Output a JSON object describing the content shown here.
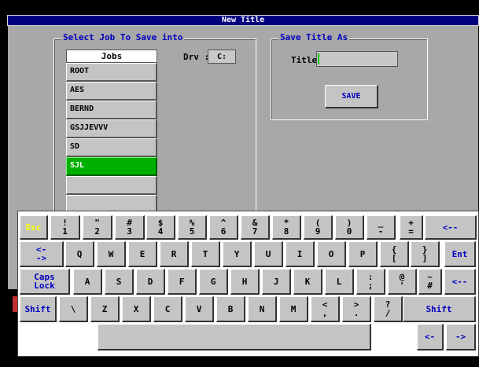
{
  "dialog": {
    "title": "New Title",
    "select_group_label": "Select Job To Save into",
    "save_group_label": "Save Title As",
    "jobs_header": "Jobs",
    "jobs": [
      "ROOT",
      "AES",
      "BERND",
      "GSJJEVVV",
      "SD",
      "SJL",
      "",
      ""
    ],
    "selected_job_index": 5,
    "drive_label": "Drv :",
    "drive_value": "C:",
    "title_label": "Title:",
    "title_value": "",
    "save_label": "SAVE"
  },
  "keyboard": {
    "row1": [
      {
        "top": "Esc",
        "bottom": ""
      },
      {
        "top": "!",
        "bottom": "1"
      },
      {
        "top": "\"",
        "bottom": "2"
      },
      {
        "top": "#",
        "bottom": "3"
      },
      {
        "top": "$",
        "bottom": "4"
      },
      {
        "top": "%",
        "bottom": "5"
      },
      {
        "top": "^",
        "bottom": "6"
      },
      {
        "top": "&",
        "bottom": "7"
      },
      {
        "top": "*",
        "bottom": "8"
      },
      {
        "top": "(",
        "bottom": "9"
      },
      {
        "top": ")",
        "bottom": "0"
      },
      {
        "top": "_",
        "bottom": "-"
      },
      {
        "top": "+",
        "bottom": "="
      },
      {
        "top": "<--",
        "bottom": ""
      }
    ],
    "row2": [
      {
        "top": "<-",
        "bottom": "->"
      },
      {
        "top": "Q",
        "bottom": ""
      },
      {
        "top": "W",
        "bottom": ""
      },
      {
        "top": "E",
        "bottom": ""
      },
      {
        "top": "R",
        "bottom": ""
      },
      {
        "top": "T",
        "bottom": ""
      },
      {
        "top": "Y",
        "bottom": ""
      },
      {
        "top": "U",
        "bottom": ""
      },
      {
        "top": "I",
        "bottom": ""
      },
      {
        "top": "O",
        "bottom": ""
      },
      {
        "top": "P",
        "bottom": ""
      },
      {
        "top": "{",
        "bottom": "["
      },
      {
        "top": "}",
        "bottom": "]"
      },
      {
        "top": "Ent",
        "bottom": ""
      }
    ],
    "row3": [
      {
        "top": "Caps",
        "bottom": "Lock"
      },
      {
        "top": "A",
        "bottom": ""
      },
      {
        "top": "S",
        "bottom": ""
      },
      {
        "top": "D",
        "bottom": ""
      },
      {
        "top": "F",
        "bottom": ""
      },
      {
        "top": "G",
        "bottom": ""
      },
      {
        "top": "H",
        "bottom": ""
      },
      {
        "top": "J",
        "bottom": ""
      },
      {
        "top": "K",
        "bottom": ""
      },
      {
        "top": "L",
        "bottom": ""
      },
      {
        "top": ":",
        "bottom": ";"
      },
      {
        "top": "@",
        "bottom": "'"
      },
      {
        "top": "~",
        "bottom": "#"
      },
      {
        "top": "<--",
        "bottom": ""
      }
    ],
    "row4": [
      {
        "top": "Shift",
        "bottom": ""
      },
      {
        "top": "\\",
        "bottom": ""
      },
      {
        "top": "Z",
        "bottom": ""
      },
      {
        "top": "X",
        "bottom": ""
      },
      {
        "top": "C",
        "bottom": ""
      },
      {
        "top": "V",
        "bottom": ""
      },
      {
        "top": "B",
        "bottom": ""
      },
      {
        "top": "N",
        "bottom": ""
      },
      {
        "top": "M",
        "bottom": ""
      },
      {
        "top": "<",
        "bottom": ","
      },
      {
        "top": ">",
        "bottom": "."
      },
      {
        "top": "?",
        "bottom": "/"
      },
      {
        "top": "Shift",
        "bottom": ""
      }
    ],
    "row5": [
      {
        "top": "",
        "bottom": ""
      },
      {
        "top": "<-",
        "bottom": ""
      },
      {
        "top": "->",
        "bottom": ""
      }
    ]
  },
  "colors": {
    "title_bar": "#00007f",
    "selected_job": "#00b000",
    "accent_text": "#0000c0",
    "esc_text": "#ffff00"
  }
}
